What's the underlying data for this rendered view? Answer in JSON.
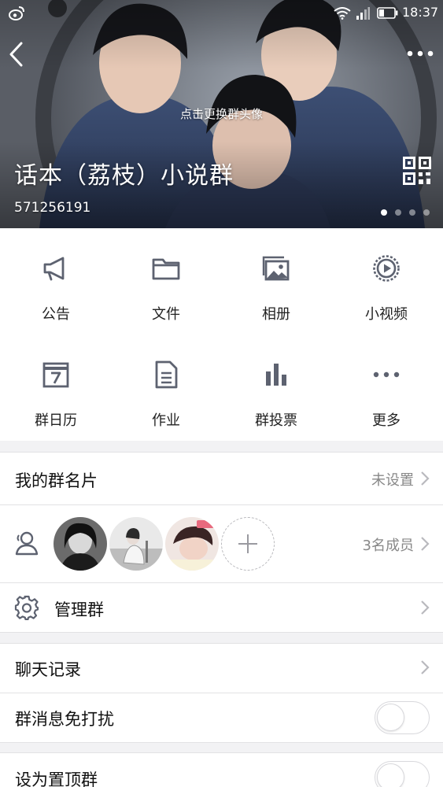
{
  "status_bar": {
    "time": "18:37",
    "icons": [
      "weibo-icon",
      "wifi-icon",
      "signal-icon",
      "battery-icon"
    ]
  },
  "header": {
    "change_avatar_hint": "点击更换群头像",
    "group_name": "话本（荔枝）小说群",
    "group_id": "571256191",
    "page_dots": 4,
    "active_dot": 1
  },
  "features": [
    {
      "label": "公告",
      "icon": "megaphone-icon"
    },
    {
      "label": "文件",
      "icon": "folder-icon"
    },
    {
      "label": "相册",
      "icon": "album-icon"
    },
    {
      "label": "小视频",
      "icon": "video-play-icon"
    },
    {
      "label": "群日历",
      "icon": "calendar-icon"
    },
    {
      "label": "作业",
      "icon": "document-icon"
    },
    {
      "label": "群投票",
      "icon": "bar-chart-icon"
    },
    {
      "label": "更多",
      "icon": "more-dots-icon"
    }
  ],
  "group_card": {
    "title": "我的群名片",
    "value": "未设置"
  },
  "members": {
    "count_text": "3名成员",
    "avatar_count": 3
  },
  "manage": {
    "title": "管理群"
  },
  "chat_history": {
    "title": "聊天记录"
  },
  "mute": {
    "title": "群消息免打扰",
    "enabled": false
  },
  "pin": {
    "title": "设为置顶群",
    "enabled": false
  },
  "colors": {
    "icon_gray": "#5d6270",
    "chevron": "#b9b9be",
    "page_bg": "#f2f2f4"
  }
}
